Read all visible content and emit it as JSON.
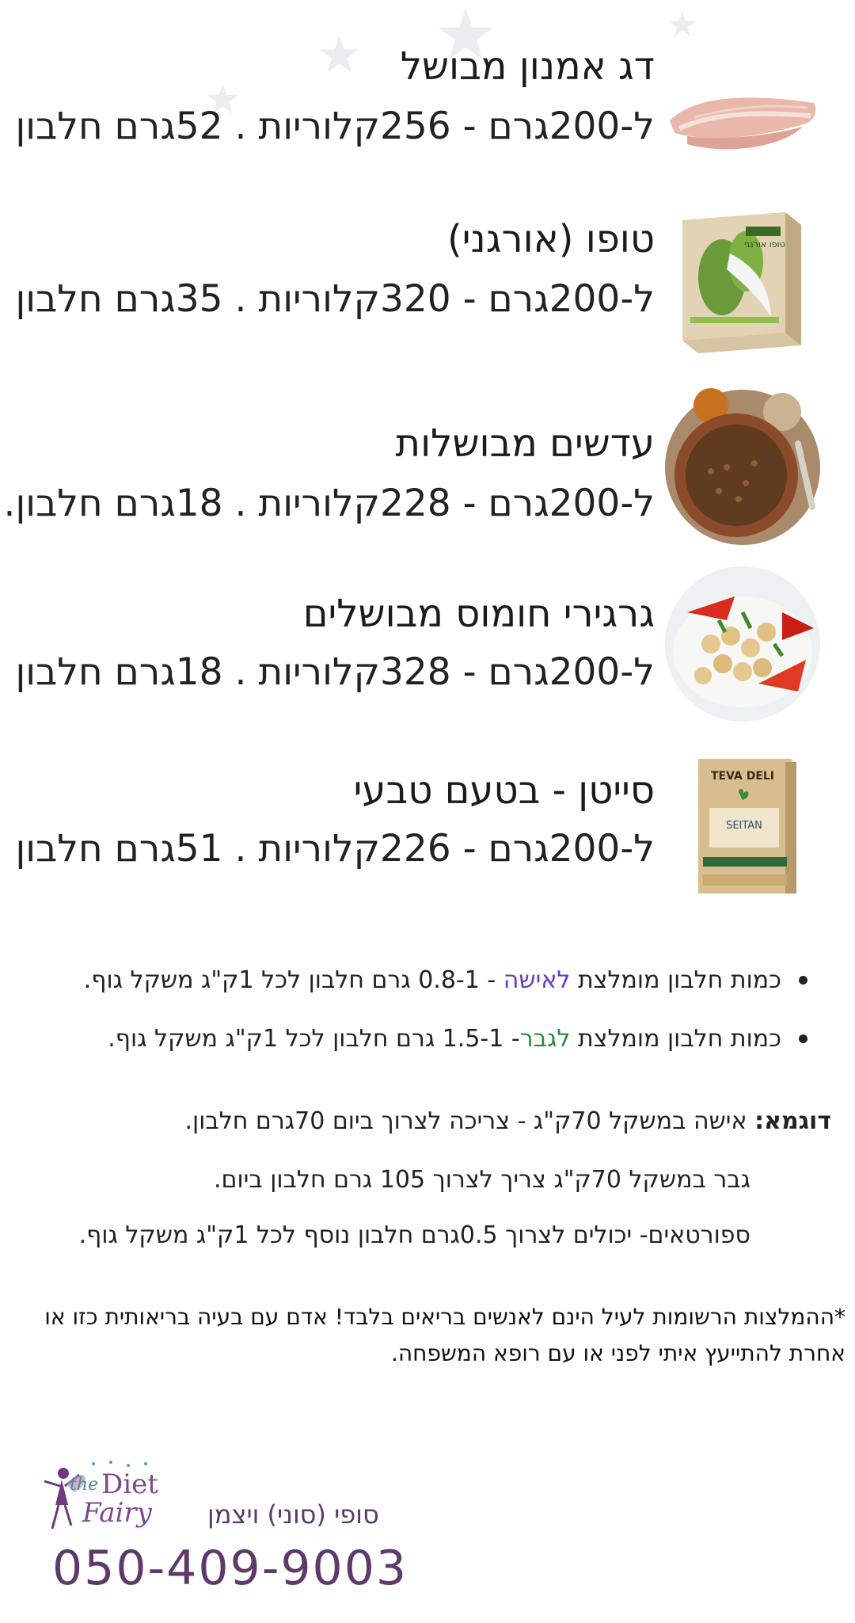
{
  "foods": [
    {
      "name": "דג אמנון מבושל",
      "details": "ל-200גרם - 256קלוריות . 52גרם חלבון",
      "image": "fish-fillet"
    },
    {
      "name": "טופו (אורגני)",
      "details": "ל-200גרם - 320קלוריות . 35גרם חלבון",
      "image": "tofu-package",
      "package_text": "טופו אורגני"
    },
    {
      "name": "עדשים מבושלות",
      "details": "ל-200גרם - 228קלוריות . 18גרם חלבון.",
      "image": "lentils-bowl"
    },
    {
      "name": "גרגירי חומוס מבושלים",
      "details": "ל-200גרם - 328קלוריות . 18גרם חלבון",
      "image": "chickpea-salad"
    },
    {
      "name": "סייטן - בטעם טבעי",
      "details": "ל-200גרם - 226קלוריות . 51גרם חלבון",
      "image": "seitan-package",
      "package_brand": "TEVA DELI",
      "package_text": "SEITAN"
    }
  ],
  "recommendations": [
    {
      "prefix": "כמות חלבון מומלצת ",
      "highlight": "לאישה",
      "suffix": " - 0.8-1 גרם חלבון לכל 1ק\"ג משקל גוף.",
      "highlight_color": "#6a3ab8"
    },
    {
      "prefix": "כמות חלבון מומלצת ",
      "highlight": "לגבר",
      "suffix": "- 1.5-1 גרם חלבון לכל 1ק\"ג משקל גוף.",
      "highlight_color": "#2f8a3e"
    }
  ],
  "example": {
    "label": "דוגמא:",
    "line1": " אישה במשקל 70ק\"ג - צריכה לצרוך ביום 70גרם חלבון.",
    "line2": "גבר במשקל 70ק\"ג צריך לצרוך 105 גרם חלבון ביום.",
    "line3": "ספורטאים- יכולים לצרוך 0.5גרם חלבון נוסף לכל 1ק\"ג משקל גוף."
  },
  "note": "*ההמלצות הרשומות לעיל הינם לאנשים בריאים בלבד! אדם עם בעיה בריאותית כזו או אחרת להתייעץ איתי לפני או עם רופא המשפחה.",
  "footer": {
    "logo_the": "the",
    "logo_diet": "Diet",
    "logo_fairy": "Fairy",
    "name": "סופי (סוני) ויצמן",
    "phone": "050-409-9003"
  },
  "colors": {
    "accent_purple": "#5d3a6a",
    "woman": "#6a3ab8",
    "man": "#2f8a3e"
  }
}
